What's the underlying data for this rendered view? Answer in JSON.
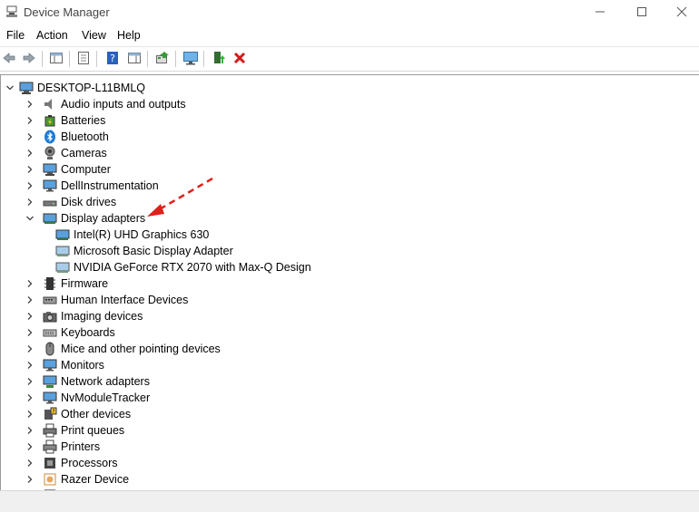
{
  "window": {
    "title": "Device Manager",
    "icons": {
      "app": "device-manager-icon",
      "minimize": "minimize-icon",
      "maximize": "maximize-icon",
      "close": "close-icon"
    }
  },
  "menu": [
    "File",
    "Action",
    "View",
    "Help"
  ],
  "toolbar": {
    "icons": [
      "back-icon",
      "forward-icon",
      "show-hide-console-tree-icon",
      "properties-icon",
      "help-icon",
      "action-pane-icon",
      "update-driver-icon",
      "scan-hardware-icon",
      "enable-device-icon",
      "uninstall-device-icon"
    ]
  },
  "tree": {
    "root": "DESKTOP-L11BMLQ",
    "categories": [
      {
        "label": "Audio inputs and outputs",
        "icon": "speaker-icon",
        "expanded": false
      },
      {
        "label": "Batteries",
        "icon": "battery-icon",
        "expanded": false
      },
      {
        "label": "Bluetooth",
        "icon": "bluetooth-icon",
        "expanded": false
      },
      {
        "label": "Cameras",
        "icon": "camera-icon",
        "expanded": false
      },
      {
        "label": "Computer",
        "icon": "computer-icon",
        "expanded": false
      },
      {
        "label": "DellInstrumentation",
        "icon": "monitor-icon",
        "expanded": false
      },
      {
        "label": "Disk drives",
        "icon": "disk-drive-icon",
        "expanded": false
      },
      {
        "label": "Display adapters",
        "icon": "display-adapter-icon",
        "expanded": true,
        "children": [
          "Intel(R) UHD Graphics 630",
          "Microsoft Basic Display Adapter",
          "NVIDIA GeForce RTX 2070 with Max-Q Design"
        ]
      },
      {
        "label": "Firmware",
        "icon": "firmware-icon",
        "expanded": false
      },
      {
        "label": "Human Interface Devices",
        "icon": "hid-icon",
        "expanded": false
      },
      {
        "label": "Imaging devices",
        "icon": "imaging-icon",
        "expanded": false
      },
      {
        "label": "Keyboards",
        "icon": "keyboard-icon",
        "expanded": false
      },
      {
        "label": "Mice and other pointing devices",
        "icon": "mouse-icon",
        "expanded": false
      },
      {
        "label": "Monitors",
        "icon": "monitor-icon",
        "expanded": false
      },
      {
        "label": "Network adapters",
        "icon": "network-icon",
        "expanded": false
      },
      {
        "label": "NvModuleTracker",
        "icon": "monitor-icon",
        "expanded": false
      },
      {
        "label": "Other devices",
        "icon": "unknown-device-icon",
        "expanded": false
      },
      {
        "label": "Print queues",
        "icon": "print-queue-icon",
        "expanded": false
      },
      {
        "label": "Printers",
        "icon": "printer-icon",
        "expanded": false
      },
      {
        "label": "Processors",
        "icon": "processor-icon",
        "expanded": false
      },
      {
        "label": "Razer Device",
        "icon": "razer-icon",
        "expanded": false
      }
    ]
  },
  "annotation": {
    "type": "arrow",
    "color": "#e0201b"
  },
  "colors": {
    "accent": "#1e7bd6",
    "uninstall": "#d11a1a",
    "annotation": "#e0201b"
  }
}
